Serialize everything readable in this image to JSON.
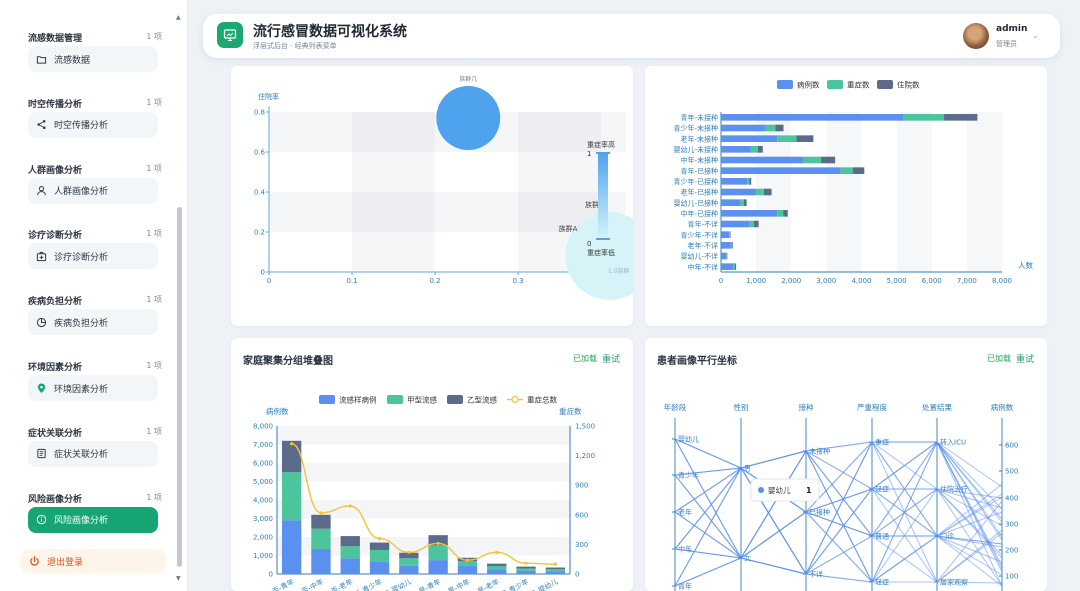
{
  "sidebar": {
    "groups": [
      {
        "title": "流感数据管理",
        "count": "1 项",
        "item": "流感数据",
        "icon": "folder-icon",
        "active": false
      },
      {
        "title": "时空传播分析",
        "count": "1 项",
        "item": "时空传播分析",
        "icon": "share-icon",
        "active": false
      },
      {
        "title": "人群画像分析",
        "count": "1 项",
        "item": "人群画像分析",
        "icon": "user-icon",
        "active": false
      },
      {
        "title": "诊疗诊断分析",
        "count": "1 项",
        "item": "诊疗诊断分析",
        "icon": "medical-kit-icon",
        "active": false
      },
      {
        "title": "疾病负担分析",
        "count": "1 项",
        "item": "疾病负担分析",
        "icon": "pie-icon",
        "active": false
      },
      {
        "title": "环境因素分析",
        "count": "1 项",
        "item": "环境因素分析",
        "icon": "location-pin-icon",
        "active": false
      },
      {
        "title": "症状关联分析",
        "count": "1 项",
        "item": "症状关联分析",
        "icon": "document-icon",
        "active": false
      },
      {
        "title": "风险画像分析",
        "count": "1 项",
        "item": "风险画像分析",
        "icon": "info-icon",
        "active": true
      }
    ],
    "logout": "退出登录",
    "accent": "#17a673"
  },
  "header": {
    "title": "流行感冒数据可视化系统",
    "subtitle": "浮层式后台 · 经典列表菜单",
    "user": "admin",
    "role": "管理员"
  },
  "cards": {
    "stacked": {
      "title": "家庭聚集分组堆叠图",
      "status": "已加载",
      "reset": "重试"
    },
    "parallel": {
      "title": "患者画像平行坐标",
      "status": "已加载",
      "reset": "重试"
    }
  },
  "chart_data": [
    {
      "type": "scatter",
      "ylabel": "住院率",
      "x_ticks": [
        "0",
        "0.1",
        "0.2",
        "0.3"
      ],
      "y_ticks": [
        "0",
        "0.2",
        "0.4",
        "0.6",
        "0.8"
      ],
      "xlim": [
        0,
        0.43
      ],
      "ylim": [
        0,
        0.8
      ],
      "points": [
        {
          "name": "族群1",
          "x": 0.24,
          "y": 0.77,
          "size": "large"
        },
        {
          "name": "族群A",
          "x": 0.41,
          "y": 0.08,
          "size": "large"
        }
      ],
      "point_labels": [
        "族群几",
        "族群A",
        "族群"
      ],
      "visual_map": {
        "high_label": "重症率高",
        "low_label": "重症率低",
        "max": "1",
        "min": "0"
      },
      "partial_label": "1.0族群",
      "colors": {
        "high": "#4fa3ee",
        "low": "#d6f4f8"
      }
    },
    {
      "type": "bar",
      "orientation": "horizontal",
      "stacked": true,
      "legend": [
        "病例数",
        "重症数",
        "住院数"
      ],
      "colors": [
        "#5b8ff0",
        "#4cc49c",
        "#5a6b8c"
      ],
      "categories": [
        "青年-未接种",
        "青少年-未接种",
        "老年-未接种",
        "婴幼儿-未接种",
        "中年-未接种",
        "青年-已接种",
        "青少年-已接种",
        "老年-已接种",
        "婴幼儿-已接种",
        "中年-已接种",
        "青年-不详",
        "青少年-不详",
        "老年-不详",
        "婴幼儿-不详",
        "中年-不详"
      ],
      "series": [
        {
          "name": "病例数",
          "values": [
            5200,
            1250,
            1600,
            850,
            2350,
            3400,
            750,
            1000,
            550,
            1600,
            800,
            230,
            280,
            150,
            360
          ]
        },
        {
          "name": "重症数",
          "values": [
            1150,
            300,
            550,
            200,
            500,
            350,
            60,
            220,
            100,
            170,
            140,
            20,
            30,
            15,
            40
          ]
        },
        {
          "name": "住院数",
          "values": [
            950,
            230,
            480,
            140,
            400,
            330,
            50,
            220,
            80,
            130,
            130,
            20,
            25,
            15,
            30
          ]
        }
      ],
      "x_ticks": [
        "0",
        "1,000",
        "2,000",
        "3,000",
        "4,000",
        "5,000",
        "6,000",
        "7,000",
        "8,000"
      ],
      "xlabel": "人数",
      "xlim": [
        0,
        8000
      ]
    },
    {
      "type": "bar",
      "stacked": true,
      "title": "家庭聚集分组堆叠图",
      "legend": [
        "流感样病例",
        "甲型流感",
        "乙型流感",
        "重症总数"
      ],
      "colors": [
        "#5b8ff0",
        "#4cc49c",
        "#5a6b8c",
        "#f5c236"
      ],
      "categories": [
        "否-青年",
        "否-中年",
        "否-老年",
        "否-青少年",
        "否-婴幼儿",
        "是-青年",
        "是-中年",
        "是-老年",
        "是-青少年",
        "是-婴幼儿"
      ],
      "series": [
        {
          "name": "流感样病例",
          "values": [
            2900,
            1350,
            850,
            650,
            450,
            750,
            450,
            250,
            170,
            150
          ]
        },
        {
          "name": "甲型流感",
          "values": [
            2600,
            1100,
            650,
            650,
            400,
            800,
            250,
            180,
            130,
            120
          ]
        },
        {
          "name": "乙型流感",
          "values": [
            1700,
            750,
            550,
            400,
            300,
            550,
            180,
            130,
            100,
            80
          ]
        },
        {
          "name": "重症总数",
          "axis": "right",
          "values": [
            1320,
            620,
            690,
            360,
            220,
            310,
            140,
            220,
            110,
            100
          ]
        }
      ],
      "ylabel": "病例数",
      "ylabel_right": "重症数",
      "y_ticks": [
        "0",
        "1,000",
        "2,000",
        "3,000",
        "4,000",
        "5,000",
        "6,000",
        "7,000",
        "8,000"
      ],
      "y_ticks_right": [
        "0",
        "300",
        "600",
        "900",
        "1,200",
        "1,500"
      ],
      "ylim": [
        0,
        8000
      ],
      "ylim_right": [
        0,
        1500
      ]
    },
    {
      "type": "parallel",
      "title": "患者画像平行坐标",
      "axes": [
        "年龄段",
        "性别",
        "接种",
        "严重程度",
        "处置结果",
        "病例数"
      ],
      "axis_labels": {
        "年龄段": [
          "婴幼儿",
          "青少年",
          "老年",
          "中年",
          "青年"
        ],
        "性别": [
          "男",
          "女"
        ],
        "接种": [
          "不详",
          "已接种",
          "未接种"
        ],
        "严重程度": [
          "重症",
          "轻症",
          "普通",
          "轻症"
        ],
        "处置结果": [
          "转入ICU",
          "住院治疗",
          "门诊",
          "居家观察"
        ],
        "病例数": [
          "600",
          "500",
          "400",
          "300",
          "200",
          "100"
        ]
      },
      "tooltip": {
        "label": "婴幼儿",
        "value": "1"
      },
      "line_color": "#5b8ff0"
    }
  ]
}
